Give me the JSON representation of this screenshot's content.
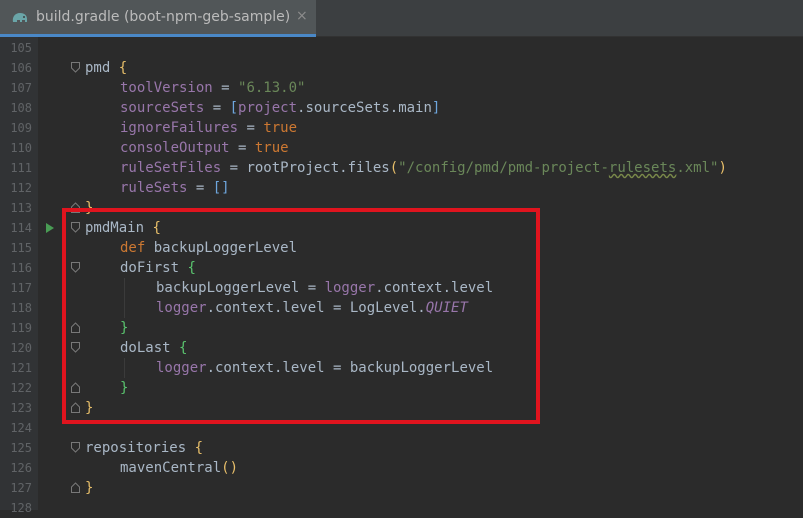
{
  "tab": {
    "title": "build.gradle (boot-npm-geb-sample)",
    "close": "×",
    "icon": "gradle-elephant-icon"
  },
  "colors": {
    "background": "#2b2b2b",
    "gutter": "#313335",
    "keyword": "#cc7832",
    "string": "#6a8759",
    "property": "#9876aa",
    "text": "#a9b7c6",
    "highlight_box": "#e0141e",
    "run": "#499c54"
  },
  "lines": [
    {
      "n": "105"
    },
    {
      "n": "106",
      "t": [
        "pmd",
        " ",
        "{"
      ]
    },
    {
      "n": "107",
      "t": [
        "toolVersion",
        " = ",
        "\"6.13.0\""
      ]
    },
    {
      "n": "108",
      "t": [
        "sourceSets",
        " = ",
        "[",
        "project",
        ".sourceSets.main",
        "]"
      ]
    },
    {
      "n": "109",
      "t": [
        "ignoreFailures",
        " = ",
        "true"
      ]
    },
    {
      "n": "110",
      "t": [
        "consoleOutput",
        " = ",
        "true"
      ]
    },
    {
      "n": "111",
      "t": [
        "ruleSetFiles",
        " = rootProject.files",
        "(",
        "\"/config/pmd/pmd-project-",
        "rulesets",
        ".xml\"",
        ")"
      ]
    },
    {
      "n": "112",
      "t": [
        "ruleSets",
        " = ",
        "[]"
      ]
    },
    {
      "n": "113",
      "t": [
        "}"
      ]
    },
    {
      "n": "114",
      "t": [
        "pmdMain",
        " ",
        "{"
      ]
    },
    {
      "n": "115",
      "t": [
        "def",
        " backupLoggerLevel"
      ]
    },
    {
      "n": "116",
      "t": [
        "doFirst",
        " ",
        "{"
      ]
    },
    {
      "n": "117",
      "t": [
        "backupLoggerLevel = ",
        "logger",
        ".context.level"
      ]
    },
    {
      "n": "118",
      "t": [
        "logger",
        ".context.level = LogLevel.",
        "QUIET"
      ]
    },
    {
      "n": "119",
      "t": [
        "}"
      ]
    },
    {
      "n": "120",
      "t": [
        "doLast",
        " ",
        "{"
      ]
    },
    {
      "n": "121",
      "t": [
        "logger",
        ".context.level = backupLoggerLevel"
      ]
    },
    {
      "n": "122",
      "t": [
        "}"
      ]
    },
    {
      "n": "123",
      "t": [
        "}"
      ]
    },
    {
      "n": "124"
    },
    {
      "n": "125",
      "t": [
        "repositories",
        " ",
        "{"
      ]
    },
    {
      "n": "126",
      "t": [
        "mavenCentral",
        "()"
      ]
    },
    {
      "n": "127",
      "t": [
        "}"
      ]
    },
    {
      "n": "128"
    }
  ]
}
